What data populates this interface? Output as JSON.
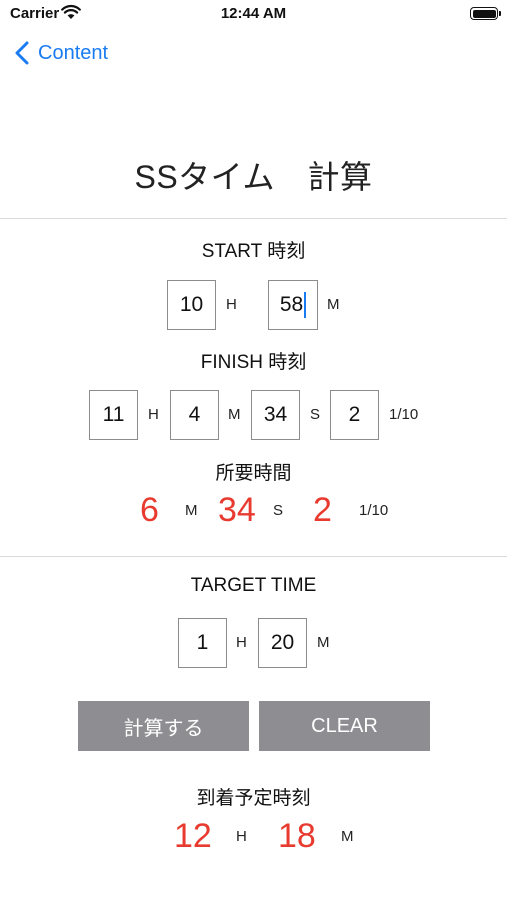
{
  "status_bar": {
    "carrier": "Carrier",
    "time": "12:44 AM"
  },
  "nav": {
    "back_label": "Content"
  },
  "title": "SSタイム　計算",
  "start": {
    "label": "START 時刻",
    "hour": "10",
    "hour_unit": "H",
    "minute": "58",
    "minute_unit": "M"
  },
  "finish": {
    "label": "FINISH 時刻",
    "hour": "11",
    "hour_unit": "H",
    "minute": "4",
    "minute_unit": "M",
    "second": "34",
    "second_unit": "S",
    "tenth": "2",
    "tenth_unit": "1/10"
  },
  "elapsed": {
    "label": "所要時間",
    "minute": "6",
    "minute_unit": "M",
    "second": "34",
    "second_unit": "S",
    "tenth": "2",
    "tenth_unit": "1/10"
  },
  "target": {
    "label": "TARGET TIME",
    "hour": "1",
    "hour_unit": "H",
    "minute": "20",
    "minute_unit": "M"
  },
  "buttons": {
    "calculate": "計算する",
    "clear": "CLEAR"
  },
  "arrival": {
    "label": "到着予定時刻",
    "hour": "12",
    "hour_unit": "H",
    "minute": "18",
    "minute_unit": "M"
  },
  "colors": {
    "accent_blue": "#1a7cf2",
    "result_red": "#e83a2f",
    "button_gray": "#8e8e92"
  }
}
